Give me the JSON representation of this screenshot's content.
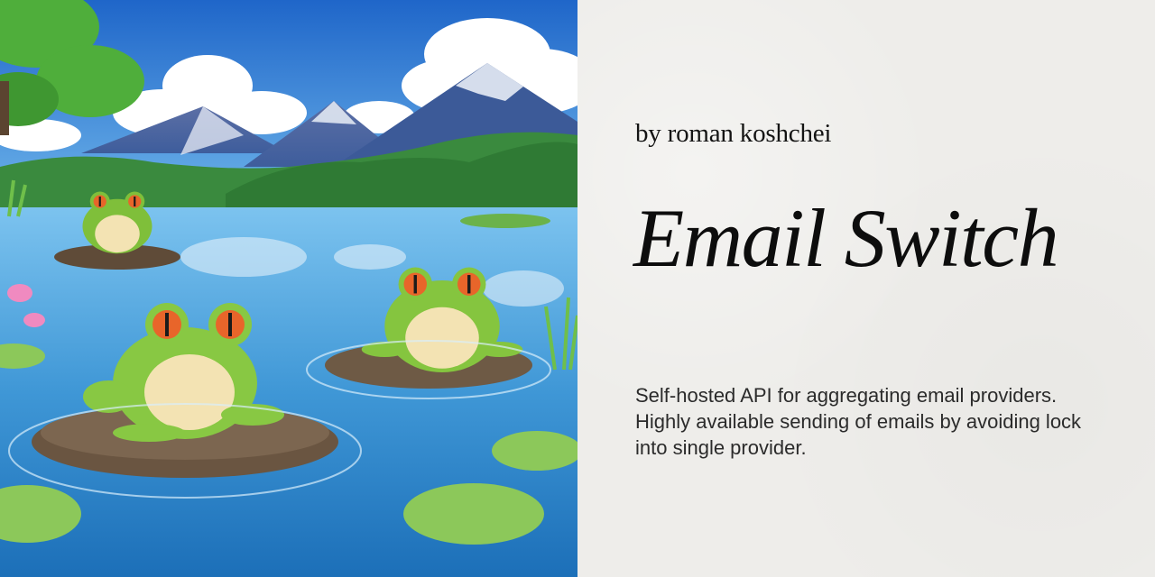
{
  "card": {
    "byline": "by roman koshchei",
    "title": "Email Switch",
    "description": "Self-hosted API for aggregating email providers. Highly available sending of emails by avoiding lock into single provider."
  },
  "illustration": {
    "subject": "three frogs on rocks in a mountain lake",
    "colors": {
      "sky": "#2f7fd6",
      "water": "#3e9ad6",
      "frog": "#8cc63f",
      "frog_belly": "#f3e3b3",
      "eye": "#e8652a",
      "rock": "#6e5a45"
    }
  }
}
